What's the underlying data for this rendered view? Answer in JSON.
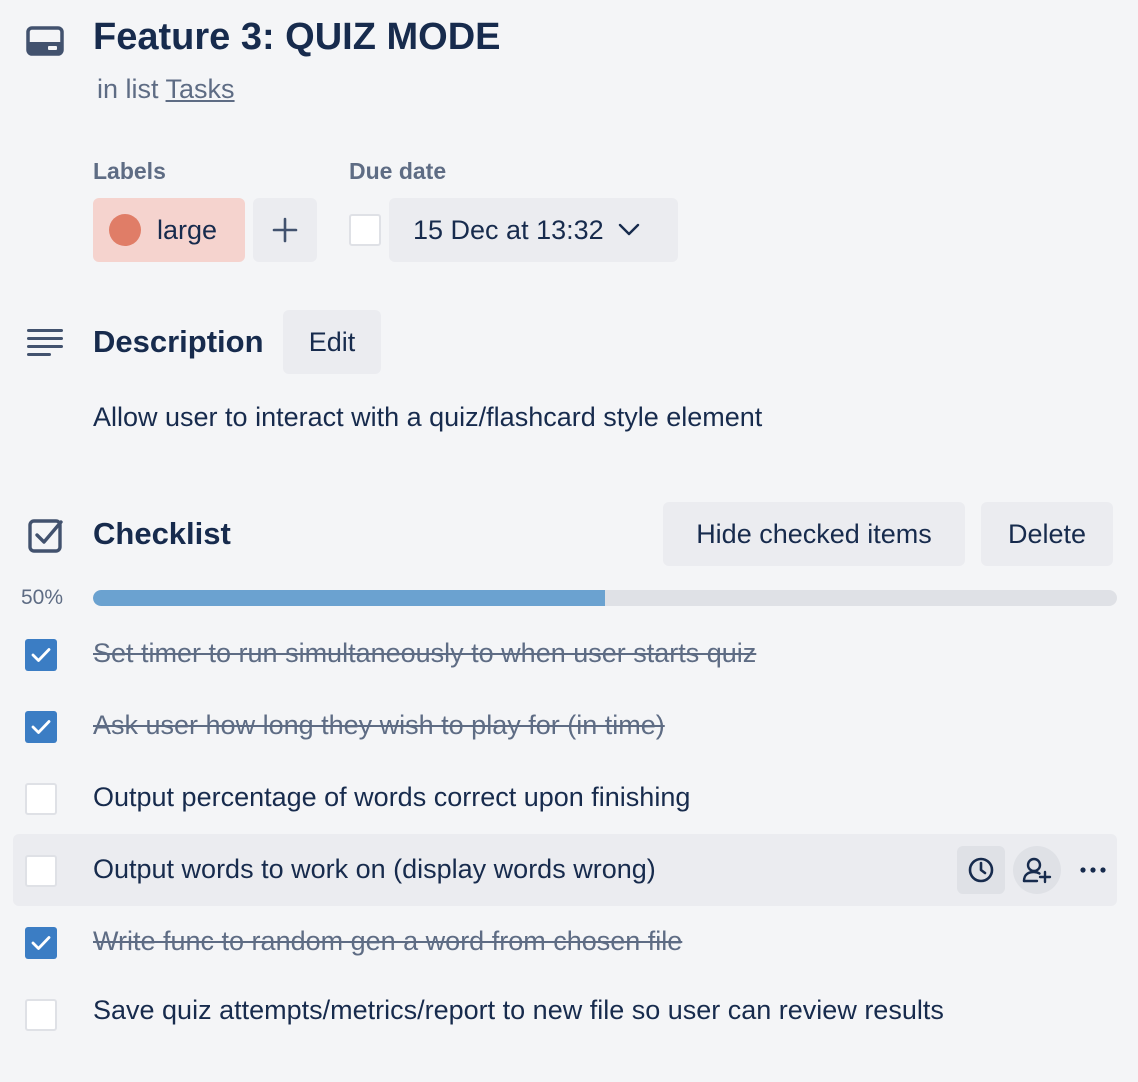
{
  "card": {
    "title": "Feature 3: QUIZ MODE",
    "list_prefix": "in list",
    "list_name": "Tasks"
  },
  "labels": {
    "heading": "Labels",
    "items": [
      {
        "name": "large",
        "color": "#e07d67",
        "bg": "#f5d3ce"
      }
    ],
    "add_icon": "plus-icon"
  },
  "due_date": {
    "heading": "Due date",
    "value": "15 Dec at 13:32",
    "complete": false
  },
  "description": {
    "heading": "Description",
    "edit_label": "Edit",
    "text": "Allow user to interact with a quiz/flashcard style element"
  },
  "checklist": {
    "heading": "Checklist",
    "hide_label": "Hide checked items",
    "delete_label": "Delete",
    "progress_text": "50%",
    "progress": 0.5,
    "items": [
      {
        "text": "Set timer to run simultaneously to when user starts quiz",
        "checked": true
      },
      {
        "text": "Ask user how long they wish to play for (in time)",
        "checked": true
      },
      {
        "text": "Output percentage of words correct upon finishing",
        "checked": false
      },
      {
        "text": "Output words to work on (display words wrong)",
        "checked": false
      },
      {
        "text": "Write func to random gen a word from chosen file",
        "checked": true
      },
      {
        "text": "Save quiz attempts/metrics/report to new file so user can review results",
        "checked": false
      }
    ],
    "row_actions": [
      "clock-icon",
      "add-member-icon",
      "more-icon"
    ]
  },
  "colors": {
    "background": "#f4f5f7",
    "text": "#172b4d",
    "muted": "#5e6c84",
    "accent": "#3b7dc4",
    "progress": "#6ba2d0"
  }
}
